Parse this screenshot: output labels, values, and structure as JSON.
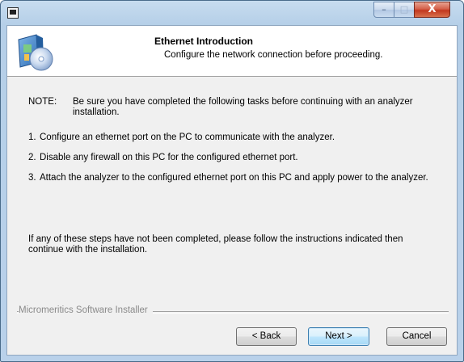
{
  "window": {
    "title": "",
    "caption_buttons": {
      "minimize_glyph": "–",
      "maximize_glyph": "□",
      "close_glyph": "X"
    }
  },
  "header": {
    "title": "Ethernet Introduction",
    "subtitle": "Configure the network connection before proceeding.",
    "icon": "installer-disc-box-icon"
  },
  "body": {
    "note_label": "NOTE:",
    "note_text": "Be sure you have completed the following tasks before continuing with an analyzer installation.",
    "steps": [
      {
        "num": "1.",
        "text": "Configure an ethernet port on the PC to communicate with the analyzer."
      },
      {
        "num": "2.",
        "text": "Disable any firewall on this PC for the configured ethernet port."
      },
      {
        "num": "3.",
        "text": "Attach the analyzer to the configured ethernet port on this PC and apply power to the analyzer."
      }
    ],
    "closing": "If any of these steps have not been completed, please follow the instructions indicated then continue with the installation."
  },
  "footer": {
    "group_label": "Micromeritics Software Installer",
    "back_label": "< Back",
    "next_label": "Next >",
    "cancel_label": "Cancel"
  },
  "colors": {
    "window_frame": "#b9d1ea",
    "dialog_bg": "#f0f0f0",
    "header_bg": "#ffffff",
    "close_button": "#c2381f",
    "default_button_border": "#3c7fb1"
  }
}
